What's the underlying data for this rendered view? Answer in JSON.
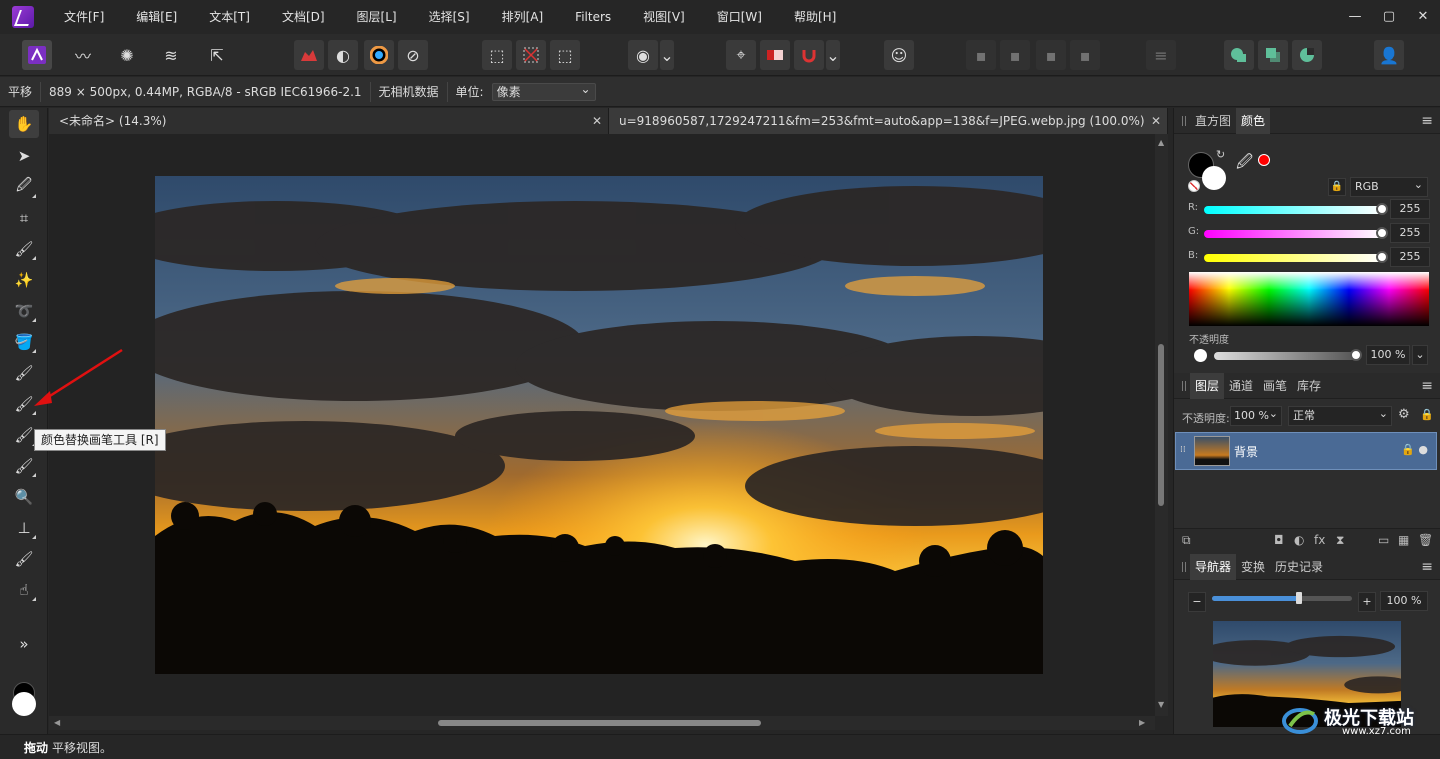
{
  "app": {
    "logo_icon": "affinity-photo-logo-icon"
  },
  "menu": [
    "文件[F]",
    "编辑[E]",
    "文本[T]",
    "文档[D]",
    "图层[L]",
    "选择[S]",
    "排列[A]",
    "Filters",
    "视图[V]",
    "窗口[W]",
    "帮助[H]"
  ],
  "window_controls": {
    "minimize": "—",
    "maximize": "▢",
    "close": "✕"
  },
  "context_bar": {
    "tool_name": "平移",
    "doc_info": "889 × 500px, 0.44MP, RGBA/8 - sRGB IEC61966-2.1",
    "camera": "无相机数据",
    "unit_label": "单位:",
    "unit_value": "像素"
  },
  "doc_tabs": [
    {
      "title": "<未命名> (14.3%)",
      "close": "✕"
    },
    {
      "title": "u=918960587,1729247211&fm=253&fmt=auto&app=138&f=JPEG.webp.jpg (100.0%)",
      "close": "✕"
    }
  ],
  "tooltip": "颜色替换画笔工具 [R]",
  "tools_more": "»",
  "status": {
    "strong": "拖动",
    "text": "平移视图。"
  },
  "color_panel": {
    "tabs": [
      "直方图",
      "颜色"
    ],
    "active_tab": "颜色",
    "model": "RGB",
    "r_label": "R:",
    "g_label": "G:",
    "b_label": "B:",
    "r": "255",
    "g": "255",
    "b": "255",
    "opacity_label": "不透明度",
    "opacity": "100 %",
    "accent_red": "#ff0000"
  },
  "layers_panel": {
    "tabs": [
      "图层",
      "通道",
      "画笔",
      "库存"
    ],
    "active_tab": "图层",
    "opacity_label": "不透明度:",
    "opacity": "100 %",
    "blend": "正常",
    "layer_name": "背景",
    "selected_color": "#4a6a95"
  },
  "navigator_panel": {
    "tabs": [
      "导航器",
      "变换",
      "历史记录"
    ],
    "active_tab": "导航器",
    "zoom": "100 %",
    "zoom_fraction": 0.62
  },
  "watermark": {
    "text": "极光下载站",
    "url": "www.xz7.com"
  }
}
